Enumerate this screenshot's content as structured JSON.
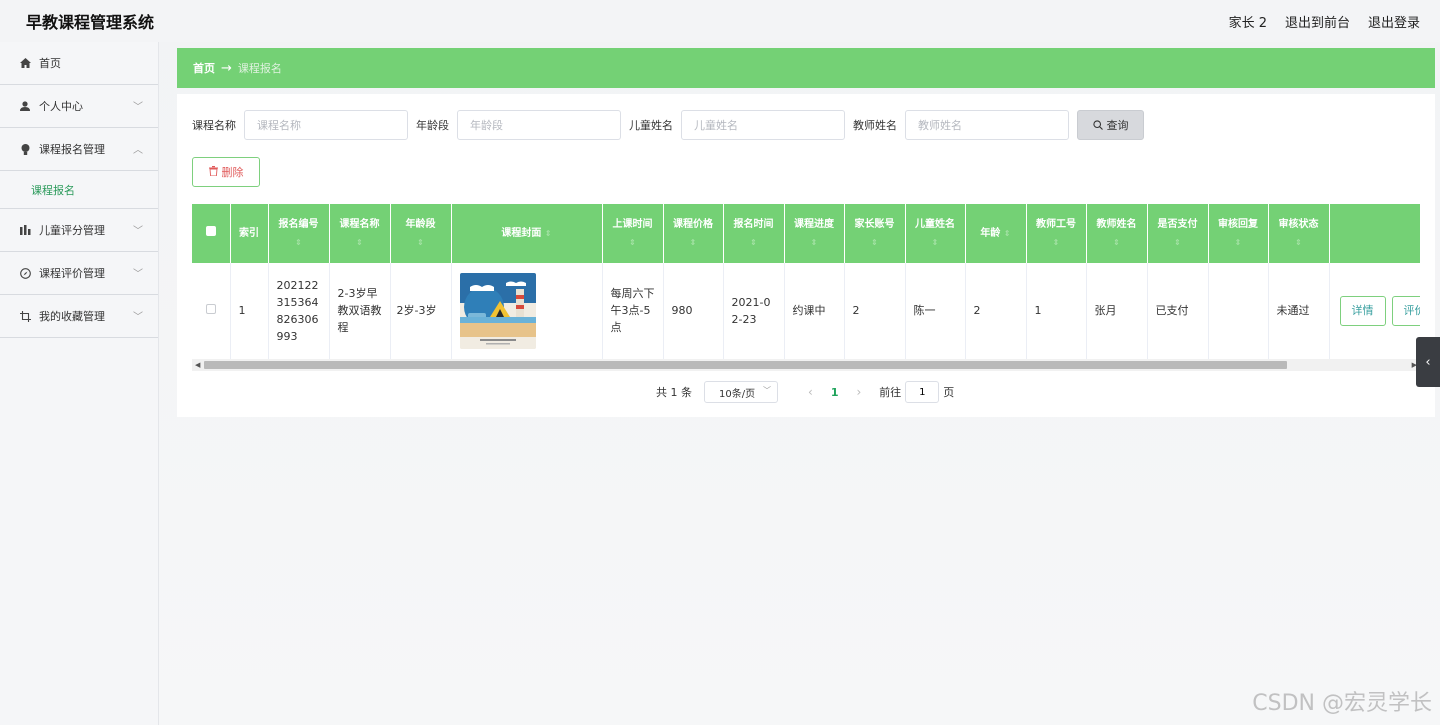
{
  "header": {
    "title": "早教课程管理系统",
    "user": "家长 2",
    "back_front": "退出到前台",
    "logout": "退出登录"
  },
  "sidebar": {
    "items": [
      {
        "label": "首页",
        "icon": "home-icon"
      },
      {
        "label": "个人中心",
        "icon": "user-icon"
      },
      {
        "label": "课程报名管理",
        "icon": "bulb-icon"
      },
      {
        "label": "儿童评分管理",
        "icon": "chart-icon"
      },
      {
        "label": "课程评价管理",
        "icon": "compass-icon"
      },
      {
        "label": "我的收藏管理",
        "icon": "crop-icon"
      }
    ],
    "sub_item": "课程报名"
  },
  "breadcrumb": {
    "home": "首页",
    "arrow": "→",
    "current": "课程报名"
  },
  "search": {
    "course_name_label": "课程名称",
    "course_name_placeholder": "课程名称",
    "age_label": "年龄段",
    "age_placeholder": "年龄段",
    "child_label": "儿童姓名",
    "child_placeholder": "儿童姓名",
    "teacher_label": "教师姓名",
    "teacher_placeholder": "教师姓名",
    "query_label": "查询"
  },
  "actions": {
    "delete_label": "删除"
  },
  "table": {
    "headers": [
      "索引",
      "报名编号",
      "课程名称",
      "年龄段",
      "课程封面",
      "上课时间",
      "课程价格",
      "报名时间",
      "课程进度",
      "家长账号",
      "儿童姓名",
      "年龄",
      "教师工号",
      "教师姓名",
      "是否支付",
      "审核回复",
      "审核状态"
    ],
    "row": {
      "index": "1",
      "signup_no": "20212231536482630​6993",
      "course_name": "2-3岁早教双语教程",
      "age_range": "2岁-3岁",
      "class_time": "每周六下午3点-5点",
      "price": "980",
      "signup_time": "2021-02-23",
      "progress": "约课中",
      "parent_account": "2",
      "child_name": "陈一",
      "age": "2",
      "teacher_no": "1",
      "teacher_name": "张月",
      "paid": "已支付",
      "reply": "",
      "status": "未通过",
      "detail_btn": "详情",
      "review_btn": "评价"
    }
  },
  "pagination": {
    "total": "共 1 条",
    "page_size": "10条/页",
    "current_page": "1",
    "goto_label": "前往",
    "goto_value": "1",
    "page_unit": "页"
  },
  "watermark": "CSDN @宏灵学长",
  "colors": {
    "accent": "#74d175",
    "active_text": "#2a9a5a"
  }
}
